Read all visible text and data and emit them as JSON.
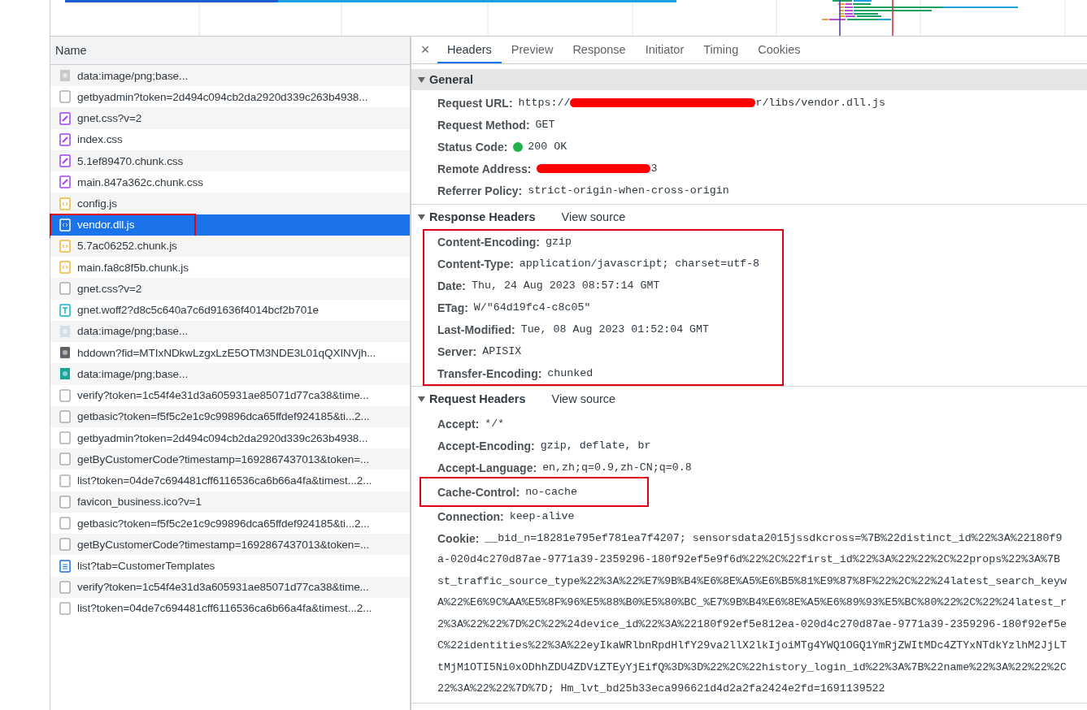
{
  "requests": {
    "column_title": "Name",
    "rows": [
      {
        "name": "data:image/png;base...",
        "kind": "image",
        "color": "#c8c8c8",
        "selected": false
      },
      {
        "name": "getbyadmin?token=2d494c094cb2da2920d339c263b4938...",
        "kind": "other",
        "selected": false
      },
      {
        "name": "gnet.css?v=2",
        "kind": "stylesheet",
        "selected": false
      },
      {
        "name": "index.css",
        "kind": "stylesheet",
        "selected": false
      },
      {
        "name": "5.1ef89470.chunk.css",
        "kind": "stylesheet",
        "selected": false
      },
      {
        "name": "main.847a362c.chunk.css",
        "kind": "stylesheet",
        "selected": false
      },
      {
        "name": "config.js",
        "kind": "script",
        "selected": false
      },
      {
        "name": "vendor.dll.js",
        "kind": "script",
        "selected": true,
        "highlighted": true
      },
      {
        "name": "5.7ac06252.chunk.js",
        "kind": "script",
        "selected": false
      },
      {
        "name": "main.fa8c8f5b.chunk.js",
        "kind": "script",
        "selected": false
      },
      {
        "name": "gnet.css?v=2",
        "kind": "other",
        "selected": false
      },
      {
        "name": "gnet.woff2?d8c5c640a7c6d91636f4014bcf2b701e",
        "kind": "font",
        "selected": false
      },
      {
        "name": "data:image/png;base...",
        "kind": "image",
        "color": "#d6dde6",
        "selected": false
      },
      {
        "name": "hddown?fid=MTIxNDkwLzgxLzE5OTM3NDE3L01qQXINVjh...",
        "kind": "image",
        "color": "#5f6368",
        "selected": false
      },
      {
        "name": "data:image/png;base...",
        "kind": "image",
        "color": "#1aa39a",
        "selected": false
      },
      {
        "name": "verify?token=1c54f4e31d3a605931ae85071d77ca38&time...",
        "kind": "other",
        "selected": false
      },
      {
        "name": "getbasic?token=f5f5c2e1c9c99896dca65ffdef924185&ti...2...",
        "kind": "other",
        "selected": false
      },
      {
        "name": "getbyadmin?token=2d494c094cb2da2920d339c263b4938...",
        "kind": "other",
        "selected": false
      },
      {
        "name": "getByCustomerCode?timestamp=1692867437013&token=...",
        "kind": "other",
        "selected": false
      },
      {
        "name": "list?token=04de7c694481cff6116536ca6b66a4fa&timest...2...",
        "kind": "other",
        "selected": false
      },
      {
        "name": "favicon_business.ico?v=1",
        "kind": "other",
        "selected": false
      },
      {
        "name": "getbasic?token=f5f5c2e1c9c99896dca65ffdef924185&ti...2...",
        "kind": "other",
        "selected": false
      },
      {
        "name": "getByCustomerCode?timestamp=1692867437013&token=...",
        "kind": "other",
        "selected": false
      },
      {
        "name": "list?tab=CustomerTemplates",
        "kind": "document",
        "selected": false
      },
      {
        "name": "verify?token=1c54f4e31d3a605931ae85071d77ca38&time...",
        "kind": "other",
        "selected": false
      },
      {
        "name": "list?token=04de7c694481cff6116536ca6b66a4fa&timest...2...",
        "kind": "other",
        "selected": false
      }
    ]
  },
  "details": {
    "close": "×",
    "tabs": [
      {
        "label": "Headers",
        "selected": true
      },
      {
        "label": "Preview",
        "selected": false
      },
      {
        "label": "Response",
        "selected": false
      },
      {
        "label": "Initiator",
        "selected": false
      },
      {
        "label": "Timing",
        "selected": false
      },
      {
        "label": "Cookies",
        "selected": false
      }
    ],
    "sections": [
      {
        "title": "General",
        "expanded": true,
        "kind": "shaded",
        "items": [
          {
            "name": "Request URL:",
            "value": "https://",
            "redacted": true,
            "value_after": "r/libs/vendor.dll.js"
          },
          {
            "name": "Request Method:",
            "value": "GET"
          },
          {
            "name": "Status Code:",
            "value": "200 OK",
            "color": "#22b14c"
          },
          {
            "name": "Remote Address:",
            "redacted": true,
            "value_after": "3"
          },
          {
            "name": "Referrer Policy:",
            "value": "strict-origin-when-cross-origin"
          }
        ]
      },
      {
        "title": "Response Headers",
        "expanded": true,
        "kind": "plain",
        "link": "View source",
        "highlighted": true,
        "items": [
          {
            "name": "Content-Encoding:",
            "value": "gzip"
          },
          {
            "name": "Content-Type:",
            "value": "application/javascript; charset=utf-8"
          },
          {
            "name": "Date:",
            "value": "Thu, 24 Aug 2023 08:57:14 GMT"
          },
          {
            "name": "ETag:",
            "value": "W/\"64d19fc4-c8c05\""
          },
          {
            "name": "Last-Modified:",
            "value": "Tue, 08 Aug 2023 01:52:04 GMT"
          },
          {
            "name": "Server:",
            "value": "APISIX"
          },
          {
            "name": "Transfer-Encoding:",
            "value": "chunked"
          }
        ]
      },
      {
        "title": "Request Headers",
        "expanded": true,
        "kind": "plain",
        "link": "View source",
        "items": [
          {
            "name": "Accept:",
            "value": "*/*"
          },
          {
            "name": "Accept-Encoding:",
            "value": "gzip, deflate, br"
          },
          {
            "name": "Accept-Language:",
            "value": "en,zh;q=0.9,zh-CN;q=0.8"
          },
          {
            "name": "Cache-Control:",
            "value": "no-cache",
            "highlighted": true
          },
          {
            "name": "Connection:",
            "value": "keep-alive"
          },
          {
            "name": "Cookie:",
            "value": "__bid_n=18281e795ef781ea7f4207; sensorsdata2015jssdkcross=%7B%22distinct_id%22%3A%22180f9",
            "more_lines": [
              "a-020d4c270d87ae-9771a39-2359296-180f92ef5e9f6d%22%2C%22first_id%22%3A%22%22%2C%22props%22%3A%7B",
              "st_traffic_source_type%22%3A%22%E7%9B%B4%E6%8E%A5%E6%B5%81%E9%87%8F%22%2C%22%24latest_search_keyw",
              "A%22%E6%9C%AA%E5%8F%96%E5%88%B0%E5%80%BC_%E7%9B%B4%E6%8E%A5%E6%89%93%E5%BC%80%22%2C%22%24latest_r",
              "2%3A%22%22%7D%2C%22%24device_id%22%3A%22180f92ef5e812ea-020d4c270d87ae-9771a39-2359296-180f92ef5e",
              "C%22identities%22%3A%22eyIkaWRlbnRpdHlfY29va2llX2lkIjoiMTg4YWQ1OGQ1YmRjZWItMDc4ZTYxNTdkYzlhM2JjLT",
              "tMjM1OTI5Ni0xODhhZDU4ZDViZTEyYjEifQ%3D%3D%22%2C%22history_login_id%22%3A%7B%22name%22%3A%22%22%2C",
              "22%3A%22%22%7D%7D; Hm_lvt_bd25b33eca996621d4d2a2fa2424e2fd=1691139522"
            ]
          }
        ]
      }
    ]
  }
}
